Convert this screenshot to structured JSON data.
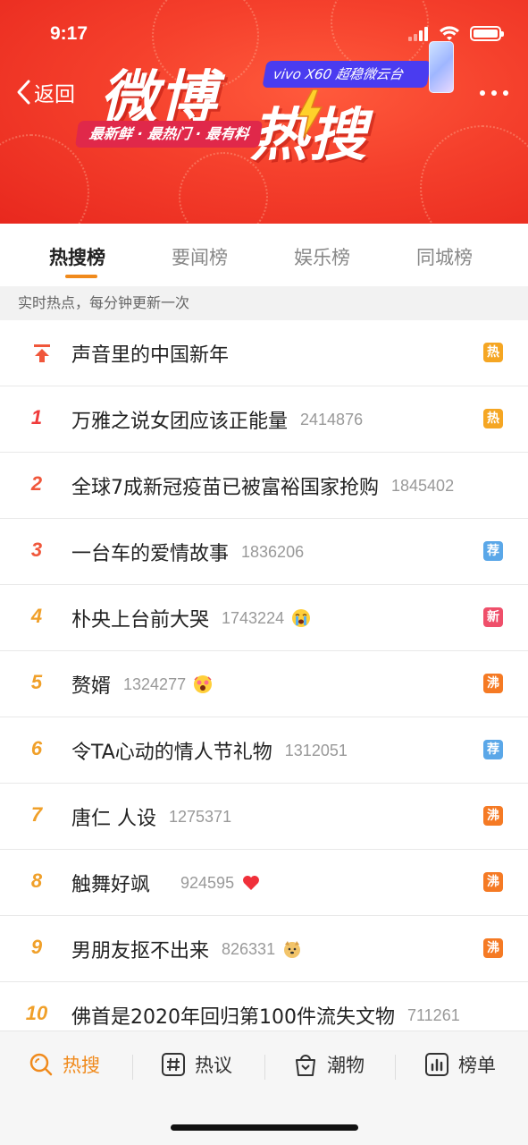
{
  "status_bar": {
    "time": "9:17"
  },
  "header": {
    "back_label": "返回",
    "logo_line1": "微博",
    "logo_line2": "热搜",
    "slogan": "最新鲜 · 最热门 · 最有料",
    "ad_text": "vivo X60 超稳微云台"
  },
  "tabs": [
    {
      "label": "热搜榜",
      "active": true
    },
    {
      "label": "要闻榜",
      "active": false
    },
    {
      "label": "娱乐榜",
      "active": false
    },
    {
      "label": "同城榜",
      "active": false
    }
  ],
  "notice": "实时热点，每分钟更新一次",
  "list": [
    {
      "rank": "",
      "rank_icon": "pin-top-icon",
      "title": "声音里的中国新年",
      "count": "",
      "emoji": "",
      "badge": "热",
      "badge_color": "#f5a623"
    },
    {
      "rank": "1",
      "title": "万雅之说女团应该正能量",
      "count": "2414876",
      "emoji": "",
      "badge": "热",
      "badge_color": "#f5a623"
    },
    {
      "rank": "2",
      "title": "全球7成新冠疫苗已被富裕国家抢购",
      "count": "1845402",
      "emoji": "",
      "badge": "",
      "badge_color": ""
    },
    {
      "rank": "3",
      "title": "一台车的爱情故事",
      "count": "1836206",
      "emoji": "",
      "badge": "荐",
      "badge_color": "#5aa7e8"
    },
    {
      "rank": "4",
      "title": "朴央上台前大哭",
      "count": "1743224",
      "emoji": "crying-emoji",
      "badge": "新",
      "badge_color": "#ef4f6a"
    },
    {
      "rank": "5",
      "title": "赘婿",
      "count": "1324277",
      "emoji": "shocked-emoji",
      "badge": "沸",
      "badge_color": "#f57a24"
    },
    {
      "rank": "6",
      "title": "令TA心动的情人节礼物",
      "count": "1312051",
      "emoji": "",
      "badge": "荐",
      "badge_color": "#5aa7e8"
    },
    {
      "rank": "7",
      "title": "唐仁 人设",
      "count": "1275371",
      "emoji": "",
      "badge": "沸",
      "badge_color": "#f57a24"
    },
    {
      "rank": "8",
      "title": "触舞好飒",
      "count": "924595",
      "emoji": "heart-emoji",
      "badge": "沸",
      "badge_color": "#f57a24"
    },
    {
      "rank": "9",
      "title": "男朋友抠不出来",
      "count": "826331",
      "emoji": "doge-emoji",
      "badge": "沸",
      "badge_color": "#f57a24"
    },
    {
      "rank": "10",
      "title": "佛首是2020年回归第100件流失文物",
      "count": "711261",
      "emoji": "",
      "badge": "",
      "badge_color": ""
    }
  ],
  "bottom_nav": [
    {
      "label": "热搜",
      "icon": "search-hot-icon",
      "active": true
    },
    {
      "label": "热议",
      "icon": "hashtag-icon",
      "active": false
    },
    {
      "label": "潮物",
      "icon": "shopping-bag-icon",
      "active": false
    },
    {
      "label": "榜单",
      "icon": "bar-chart-icon",
      "active": false
    }
  ],
  "colors": {
    "accent": "#f08a1c",
    "banner": "#f5402c"
  }
}
